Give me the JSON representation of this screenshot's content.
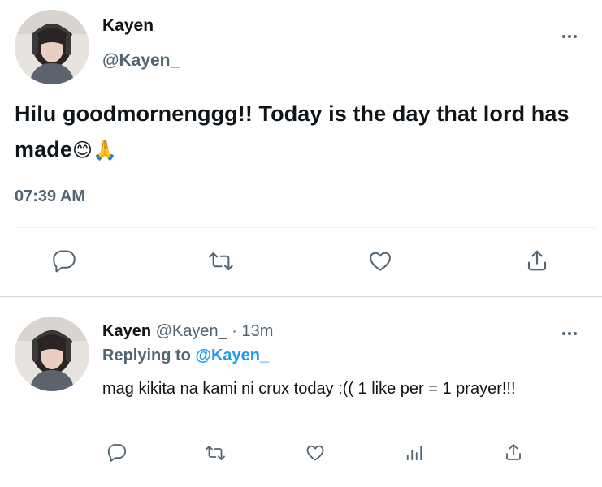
{
  "colors": {
    "text": "#0f1419",
    "muted": "#536471",
    "accent": "#1d9bf0",
    "divider": "#eff3f4"
  },
  "main_tweet": {
    "display_name": "Kayen",
    "handle": "@Kayen_",
    "text": "Hilu goodmornenggg!! Today is the day that lord has made",
    "emojis": "😊🙏",
    "time": "07:39 AM",
    "actions": [
      "reply-icon",
      "retweet-icon",
      "like-icon",
      "share-icon"
    ]
  },
  "reply_tweet": {
    "display_name": "Kayen",
    "handle": "@Kayen_",
    "separator": "·",
    "age": "13m",
    "replying_label": "Replying to",
    "replying_to": "@Kayen_",
    "text": "mag kikita na kami ni crux today :(( 1 like per = 1 prayer!!!",
    "actions": [
      "reply-icon",
      "retweet-icon",
      "like-icon",
      "analytics-icon",
      "share-icon"
    ]
  }
}
